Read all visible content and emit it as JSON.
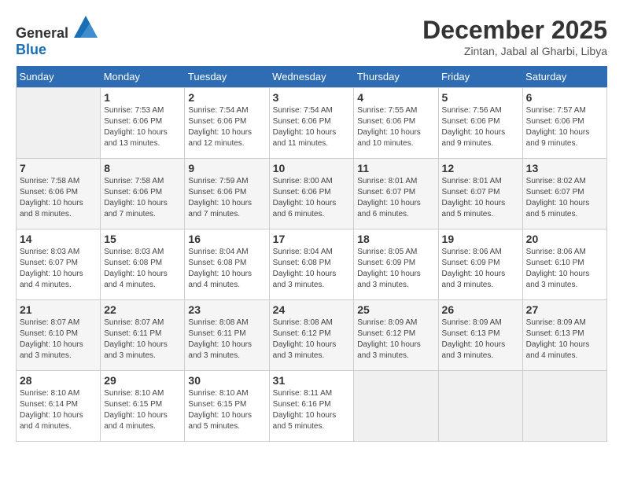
{
  "logo": {
    "general": "General",
    "blue": "Blue"
  },
  "title": {
    "month": "December 2025",
    "location": "Zintan, Jabal al Gharbi, Libya"
  },
  "headers": [
    "Sunday",
    "Monday",
    "Tuesday",
    "Wednesday",
    "Thursday",
    "Friday",
    "Saturday"
  ],
  "weeks": [
    [
      {
        "day": "",
        "sunrise": "",
        "sunset": "",
        "daylight": ""
      },
      {
        "day": "1",
        "sunrise": "Sunrise: 7:53 AM",
        "sunset": "Sunset: 6:06 PM",
        "daylight": "Daylight: 10 hours and 13 minutes."
      },
      {
        "day": "2",
        "sunrise": "Sunrise: 7:54 AM",
        "sunset": "Sunset: 6:06 PM",
        "daylight": "Daylight: 10 hours and 12 minutes."
      },
      {
        "day": "3",
        "sunrise": "Sunrise: 7:54 AM",
        "sunset": "Sunset: 6:06 PM",
        "daylight": "Daylight: 10 hours and 11 minutes."
      },
      {
        "day": "4",
        "sunrise": "Sunrise: 7:55 AM",
        "sunset": "Sunset: 6:06 PM",
        "daylight": "Daylight: 10 hours and 10 minutes."
      },
      {
        "day": "5",
        "sunrise": "Sunrise: 7:56 AM",
        "sunset": "Sunset: 6:06 PM",
        "daylight": "Daylight: 10 hours and 9 minutes."
      },
      {
        "day": "6",
        "sunrise": "Sunrise: 7:57 AM",
        "sunset": "Sunset: 6:06 PM",
        "daylight": "Daylight: 10 hours and 9 minutes."
      }
    ],
    [
      {
        "day": "7",
        "sunrise": "Sunrise: 7:58 AM",
        "sunset": "Sunset: 6:06 PM",
        "daylight": "Daylight: 10 hours and 8 minutes."
      },
      {
        "day": "8",
        "sunrise": "Sunrise: 7:58 AM",
        "sunset": "Sunset: 6:06 PM",
        "daylight": "Daylight: 10 hours and 7 minutes."
      },
      {
        "day": "9",
        "sunrise": "Sunrise: 7:59 AM",
        "sunset": "Sunset: 6:06 PM",
        "daylight": "Daylight: 10 hours and 7 minutes."
      },
      {
        "day": "10",
        "sunrise": "Sunrise: 8:00 AM",
        "sunset": "Sunset: 6:06 PM",
        "daylight": "Daylight: 10 hours and 6 minutes."
      },
      {
        "day": "11",
        "sunrise": "Sunrise: 8:01 AM",
        "sunset": "Sunset: 6:07 PM",
        "daylight": "Daylight: 10 hours and 6 minutes."
      },
      {
        "day": "12",
        "sunrise": "Sunrise: 8:01 AM",
        "sunset": "Sunset: 6:07 PM",
        "daylight": "Daylight: 10 hours and 5 minutes."
      },
      {
        "day": "13",
        "sunrise": "Sunrise: 8:02 AM",
        "sunset": "Sunset: 6:07 PM",
        "daylight": "Daylight: 10 hours and 5 minutes."
      }
    ],
    [
      {
        "day": "14",
        "sunrise": "Sunrise: 8:03 AM",
        "sunset": "Sunset: 6:07 PM",
        "daylight": "Daylight: 10 hours and 4 minutes."
      },
      {
        "day": "15",
        "sunrise": "Sunrise: 8:03 AM",
        "sunset": "Sunset: 6:08 PM",
        "daylight": "Daylight: 10 hours and 4 minutes."
      },
      {
        "day": "16",
        "sunrise": "Sunrise: 8:04 AM",
        "sunset": "Sunset: 6:08 PM",
        "daylight": "Daylight: 10 hours and 4 minutes."
      },
      {
        "day": "17",
        "sunrise": "Sunrise: 8:04 AM",
        "sunset": "Sunset: 6:08 PM",
        "daylight": "Daylight: 10 hours and 3 minutes."
      },
      {
        "day": "18",
        "sunrise": "Sunrise: 8:05 AM",
        "sunset": "Sunset: 6:09 PM",
        "daylight": "Daylight: 10 hours and 3 minutes."
      },
      {
        "day": "19",
        "sunrise": "Sunrise: 8:06 AM",
        "sunset": "Sunset: 6:09 PM",
        "daylight": "Daylight: 10 hours and 3 minutes."
      },
      {
        "day": "20",
        "sunrise": "Sunrise: 8:06 AM",
        "sunset": "Sunset: 6:10 PM",
        "daylight": "Daylight: 10 hours and 3 minutes."
      }
    ],
    [
      {
        "day": "21",
        "sunrise": "Sunrise: 8:07 AM",
        "sunset": "Sunset: 6:10 PM",
        "daylight": "Daylight: 10 hours and 3 minutes."
      },
      {
        "day": "22",
        "sunrise": "Sunrise: 8:07 AM",
        "sunset": "Sunset: 6:11 PM",
        "daylight": "Daylight: 10 hours and 3 minutes."
      },
      {
        "day": "23",
        "sunrise": "Sunrise: 8:08 AM",
        "sunset": "Sunset: 6:11 PM",
        "daylight": "Daylight: 10 hours and 3 minutes."
      },
      {
        "day": "24",
        "sunrise": "Sunrise: 8:08 AM",
        "sunset": "Sunset: 6:12 PM",
        "daylight": "Daylight: 10 hours and 3 minutes."
      },
      {
        "day": "25",
        "sunrise": "Sunrise: 8:09 AM",
        "sunset": "Sunset: 6:12 PM",
        "daylight": "Daylight: 10 hours and 3 minutes."
      },
      {
        "day": "26",
        "sunrise": "Sunrise: 8:09 AM",
        "sunset": "Sunset: 6:13 PM",
        "daylight": "Daylight: 10 hours and 3 minutes."
      },
      {
        "day": "27",
        "sunrise": "Sunrise: 8:09 AM",
        "sunset": "Sunset: 6:13 PM",
        "daylight": "Daylight: 10 hours and 4 minutes."
      }
    ],
    [
      {
        "day": "28",
        "sunrise": "Sunrise: 8:10 AM",
        "sunset": "Sunset: 6:14 PM",
        "daylight": "Daylight: 10 hours and 4 minutes."
      },
      {
        "day": "29",
        "sunrise": "Sunrise: 8:10 AM",
        "sunset": "Sunset: 6:15 PM",
        "daylight": "Daylight: 10 hours and 4 minutes."
      },
      {
        "day": "30",
        "sunrise": "Sunrise: 8:10 AM",
        "sunset": "Sunset: 6:15 PM",
        "daylight": "Daylight: 10 hours and 5 minutes."
      },
      {
        "day": "31",
        "sunrise": "Sunrise: 8:11 AM",
        "sunset": "Sunset: 6:16 PM",
        "daylight": "Daylight: 10 hours and 5 minutes."
      },
      {
        "day": "",
        "sunrise": "",
        "sunset": "",
        "daylight": ""
      },
      {
        "day": "",
        "sunrise": "",
        "sunset": "",
        "daylight": ""
      },
      {
        "day": "",
        "sunrise": "",
        "sunset": "",
        "daylight": ""
      }
    ]
  ]
}
